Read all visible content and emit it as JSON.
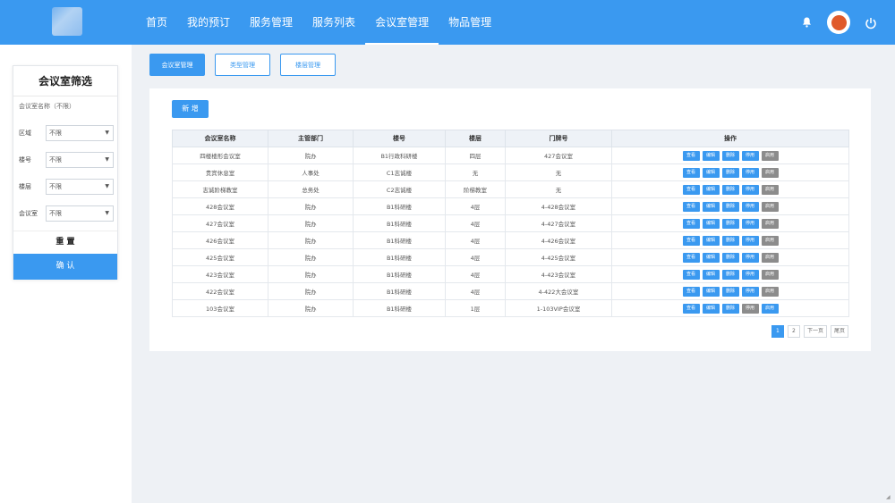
{
  "header": {
    "nav": [
      "首页",
      "我的预订",
      "服务管理",
      "服务列表",
      "会议室管理",
      "物品管理"
    ],
    "active_nav": 4,
    "icons": {
      "bell": "bell-icon",
      "avatar": "avatar",
      "power": "power-icon"
    }
  },
  "filter": {
    "title": "会议室筛选",
    "name_hint": "会议室名称（不限）",
    "fields": [
      {
        "label": "区域",
        "value": "不限"
      },
      {
        "label": "楼号",
        "value": "不限"
      },
      {
        "label": "楼层",
        "value": "不限"
      },
      {
        "label": "会议室",
        "value": "不限"
      }
    ],
    "reset": "重 置",
    "confirm": "确 认"
  },
  "tabs": [
    "会议室管理",
    "类型管理",
    "楼层管理"
  ],
  "active_tab": 0,
  "toolbar": {
    "add_label": "新 增"
  },
  "table": {
    "columns": [
      "会议室名称",
      "主管部门",
      "楼号",
      "楼层",
      "门牌号",
      "操作"
    ],
    "rows": [
      [
        "四楼楼形会议室",
        "院办",
        "B1行政科研楼",
        "四层",
        "427会议室"
      ],
      [
        "贵宾休息室",
        "人事处",
        "C1志诚楼",
        "无",
        "无"
      ],
      [
        "志诚阶梯教室",
        "总务处",
        "C2志诚楼",
        "阶梯教室",
        "无"
      ],
      [
        "428会议室",
        "院办",
        "B1科研楼",
        "4层",
        "4-428会议室"
      ],
      [
        "427会议室",
        "院办",
        "B1科研楼",
        "4层",
        "4-427会议室"
      ],
      [
        "426会议室",
        "院办",
        "B1科研楼",
        "4层",
        "4-426会议室"
      ],
      [
        "425会议室",
        "院办",
        "B1科研楼",
        "4层",
        "4-425会议室"
      ],
      [
        "423会议室",
        "院办",
        "B1科研楼",
        "4层",
        "4-423会议室"
      ],
      [
        "422会议室",
        "院办",
        "B1科研楼",
        "4层",
        "4-422大会议室"
      ],
      [
        "103会议室",
        "院办",
        "B1科研楼",
        "1层",
        "1-103VIP会议室"
      ]
    ],
    "actions": [
      "查看",
      "编辑",
      "删除",
      "停用",
      "启用"
    ],
    "status_colors": {
      "active": "#3a99f0",
      "disabled": "#8c8c8c"
    }
  },
  "pagination": {
    "pages": [
      "1",
      "2"
    ],
    "current": "1",
    "next": "下一页",
    "last": "尾页"
  },
  "colors": {
    "accent": "#3a99f0",
    "background": "#eef1f5"
  }
}
